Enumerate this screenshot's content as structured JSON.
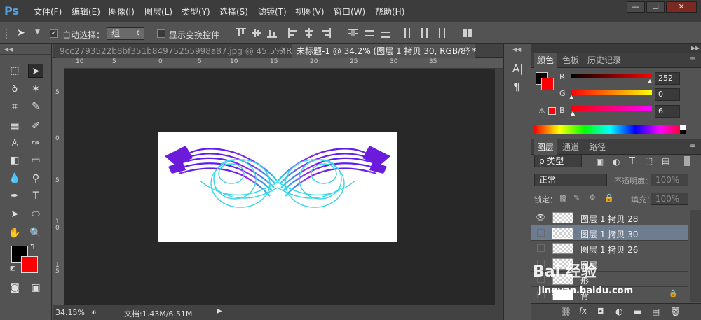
{
  "app": {
    "logo": "Ps"
  },
  "menu": [
    "文件(F)",
    "编辑(E)",
    "图像(I)",
    "图层(L)",
    "类型(Y)",
    "选择(S)",
    "滤镜(T)",
    "视图(V)",
    "窗口(W)",
    "帮助(H)"
  ],
  "window_controls": {
    "minimize": "—",
    "maximize": "☐",
    "close": "✕"
  },
  "options": {
    "auto_select_label": "自动选择：",
    "auto_select_checked": true,
    "auto_select_value": "组",
    "transform_label": "显示变换控件",
    "transform_checked": false
  },
  "tabs": [
    {
      "label": "9cc2793522b8bf351b84975255998a87.jpg @ 45.5%(RGB...",
      "close": "✕",
      "active": false
    },
    {
      "label": "未标题-1 @ 34.2% (图层 1 拷贝 30, RGB/8) *",
      "close": "✕",
      "active": true
    }
  ],
  "ruler_h": [
    "10",
    "5",
    "0",
    "5",
    "10",
    "15",
    "20",
    "25",
    "30",
    "35"
  ],
  "ruler_v": [
    "5",
    "0",
    "5",
    "1 0",
    "1 5"
  ],
  "status": {
    "zoom": "34.15%",
    "doc_label": "文档:1.43M/6.51M"
  },
  "color_panel": {
    "tabs": [
      "颜色",
      "色板",
      "历史记录"
    ],
    "r_label": "R",
    "r_value": "252",
    "g_label": "G",
    "g_value": "0",
    "b_label": "B",
    "b_value": "6",
    "fg_color": "#000000",
    "bg_color": "#fc0006"
  },
  "layers_panel": {
    "tabs": [
      "图层",
      "通道",
      "路径"
    ],
    "filter_label": "ρ 类型",
    "blend_mode": "正常",
    "opacity_label": "不透明度：",
    "opacity_value": "100%",
    "lock_label": "锁定：",
    "fill_label": "填充：",
    "fill_value": "100%",
    "layers": [
      {
        "name": "图层 1 拷贝 28",
        "visible": true,
        "selected": false
      },
      {
        "name": "图层 1 拷贝 30",
        "visible": false,
        "selected": true
      },
      {
        "name": "图层 1 拷贝 26",
        "visible": false,
        "selected": false
      },
      {
        "name": "图层",
        "visible": false,
        "selected": false
      },
      {
        "name": "形",
        "visible": false,
        "selected": false
      },
      {
        "name": "背",
        "visible": false,
        "selected": false
      }
    ]
  },
  "watermark": {
    "text": "Bai 经验",
    "url": "jingyan.baidu.com"
  }
}
